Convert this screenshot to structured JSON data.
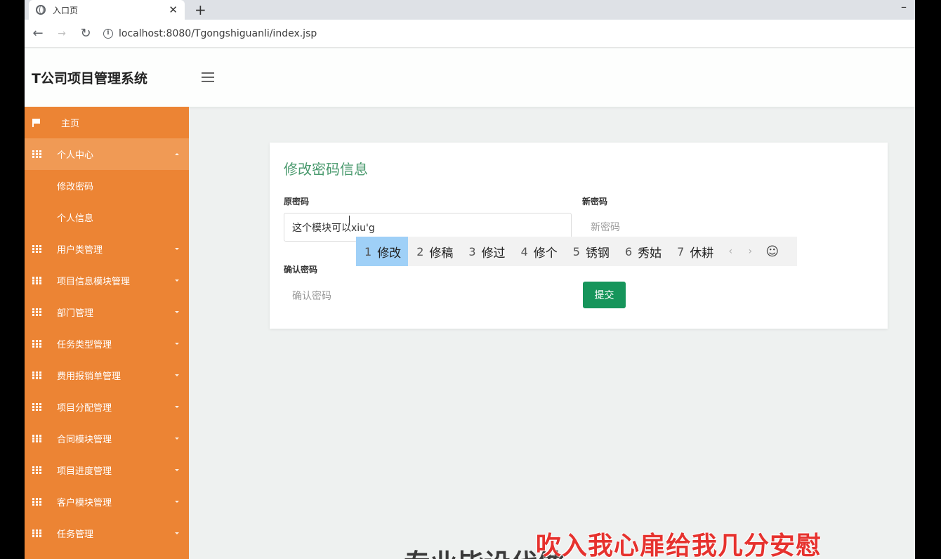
{
  "browser": {
    "tab_title": "入口页",
    "tab_close": "✕",
    "new_tab": "+",
    "minimize": "–",
    "url": "localhost:8080/Tgongshiguanli/index.jsp",
    "back": "←",
    "forward": "→",
    "reload": "↻",
    "info": "i"
  },
  "app": {
    "title": "T公司项目管理系统"
  },
  "sidebar": {
    "items": [
      {
        "label": "主页",
        "icon": "flag-icon"
      },
      {
        "label": "个人中心",
        "icon": "grid-icon",
        "expanded": true,
        "children": [
          "修改密码",
          "个人信息"
        ]
      },
      {
        "label": "用户类管理",
        "icon": "grid-icon"
      },
      {
        "label": "项目信息模块管理",
        "icon": "grid-icon"
      },
      {
        "label": "部门管理",
        "icon": "grid-icon"
      },
      {
        "label": "任务类型管理",
        "icon": "grid-icon"
      },
      {
        "label": "费用报销单管理",
        "icon": "grid-icon"
      },
      {
        "label": "项目分配管理",
        "icon": "grid-icon"
      },
      {
        "label": "合同模块管理",
        "icon": "grid-icon"
      },
      {
        "label": "项目进度管理",
        "icon": "grid-icon"
      },
      {
        "label": "客户模块管理",
        "icon": "grid-icon"
      },
      {
        "label": "任务管理",
        "icon": "grid-icon"
      }
    ]
  },
  "form": {
    "title": "修改密码信息",
    "old_password": {
      "label": "原密码",
      "value": "这个模块可以xiu'g"
    },
    "new_password": {
      "label": "新密码",
      "placeholder": "新密码"
    },
    "confirm_password": {
      "label": "确认密码",
      "placeholder": "确认密码"
    },
    "submit_label": "提交"
  },
  "ime": {
    "candidates": [
      {
        "num": "1",
        "text": "修改"
      },
      {
        "num": "2",
        "text": "修稿"
      },
      {
        "num": "3",
        "text": "修过"
      },
      {
        "num": "4",
        "text": "修个"
      },
      {
        "num": "5",
        "text": "锈钢"
      },
      {
        "num": "6",
        "text": "秀姑"
      },
      {
        "num": "7",
        "text": "休耕"
      }
    ],
    "prev": "‹",
    "next": "›",
    "emoji": "☺"
  },
  "subtitles": {
    "lyric": "吹入我心扉给我几分安慰",
    "caption": "专业毕设代做"
  },
  "colors": {
    "sidebar_bg": "#ec8434",
    "accent_green": "#16955b",
    "title_green": "#4a9a6e",
    "ime_highlight": "#9fd0f7"
  }
}
